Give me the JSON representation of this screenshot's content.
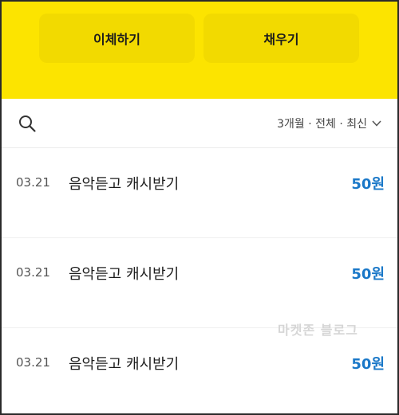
{
  "actions": {
    "transfer_label": "이체하기",
    "charge_label": "채우기"
  },
  "filter": {
    "summary": "3개월 · 전체 · 최신"
  },
  "transactions": [
    {
      "date": "03.21",
      "description": "음악듣고 캐시받기",
      "amount": "50원"
    },
    {
      "date": "03.21",
      "description": "음악듣고 캐시받기",
      "amount": "50원"
    },
    {
      "date": "03.21",
      "description": "음악듣고 캐시받기",
      "amount": "50원"
    }
  ],
  "watermark": "마켓존 블로그",
  "colors": {
    "header_yellow": "#fce400",
    "button_yellow": "#f2da00",
    "amount_blue": "#1a78c8"
  },
  "icons": {
    "search": "search-icon",
    "filter_toggle": "chevron-down-icon"
  }
}
